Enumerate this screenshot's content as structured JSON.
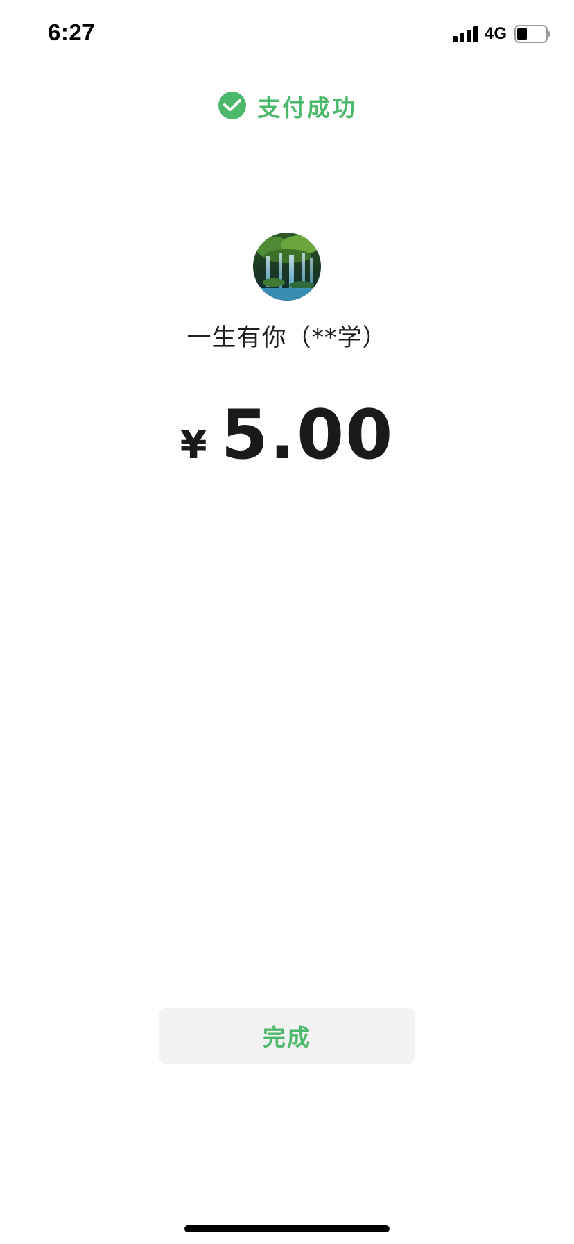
{
  "status_bar": {
    "time": "6:27",
    "network_type": "4G",
    "signal_level": 4,
    "signal_max": 4,
    "battery_level": 0.35,
    "icons": [
      "signal-icon",
      "battery-icon"
    ]
  },
  "header": {
    "icon": "wechat-pay-icon",
    "title": "支付成功"
  },
  "payee": {
    "avatar": "waterfall-avatar",
    "name": "一生有你（**学）"
  },
  "payment": {
    "currency_symbol": "¥",
    "amount": "5.00"
  },
  "actions": {
    "done_label": "完成"
  },
  "colors": {
    "accent": "#4cb86b",
    "button_bg": "#f2f2f2",
    "text": "#1f1f1f"
  }
}
